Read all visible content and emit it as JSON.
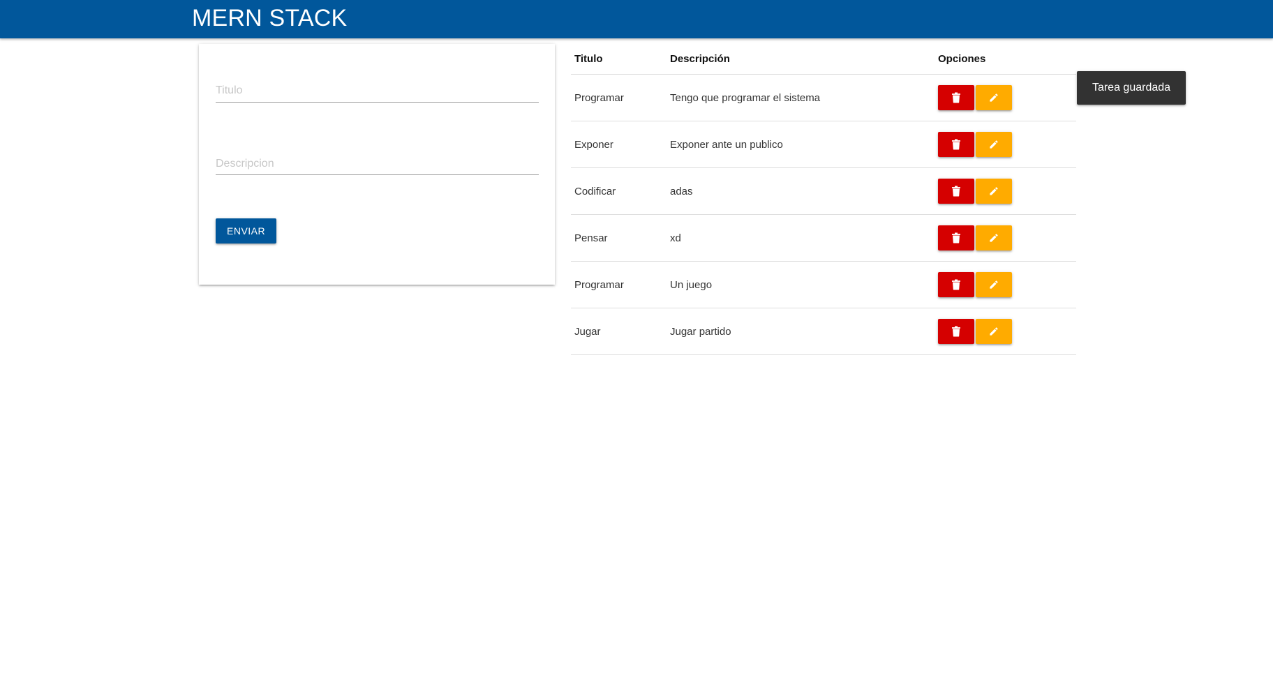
{
  "navbar": {
    "brand": "MERN STACK",
    "color": "#01579b"
  },
  "form": {
    "title_placeholder": "Titulo",
    "title_value": "",
    "description_placeholder": "Descripcion",
    "description_value": "",
    "submit_label": "ENVIAR"
  },
  "table": {
    "headers": {
      "title": "Titulo",
      "description": "Descripción",
      "options": "Opciones"
    },
    "rows": [
      {
        "title": "Programar",
        "description": "Tengo que programar el sistema"
      },
      {
        "title": "Exponer",
        "description": "Exponer ante un publico"
      },
      {
        "title": "Codificar",
        "description": "adas"
      },
      {
        "title": "Pensar",
        "description": "xd"
      },
      {
        "title": "Programar",
        "description": "Un juego"
      },
      {
        "title": "Jugar",
        "description": "Jugar partido"
      }
    ],
    "row_actions": {
      "delete_icon": "trash-icon",
      "delete_color": "#d50000",
      "edit_icon": "pencil-icon",
      "edit_color": "#ffab00"
    }
  },
  "toast": {
    "message": "Tarea guardada"
  }
}
